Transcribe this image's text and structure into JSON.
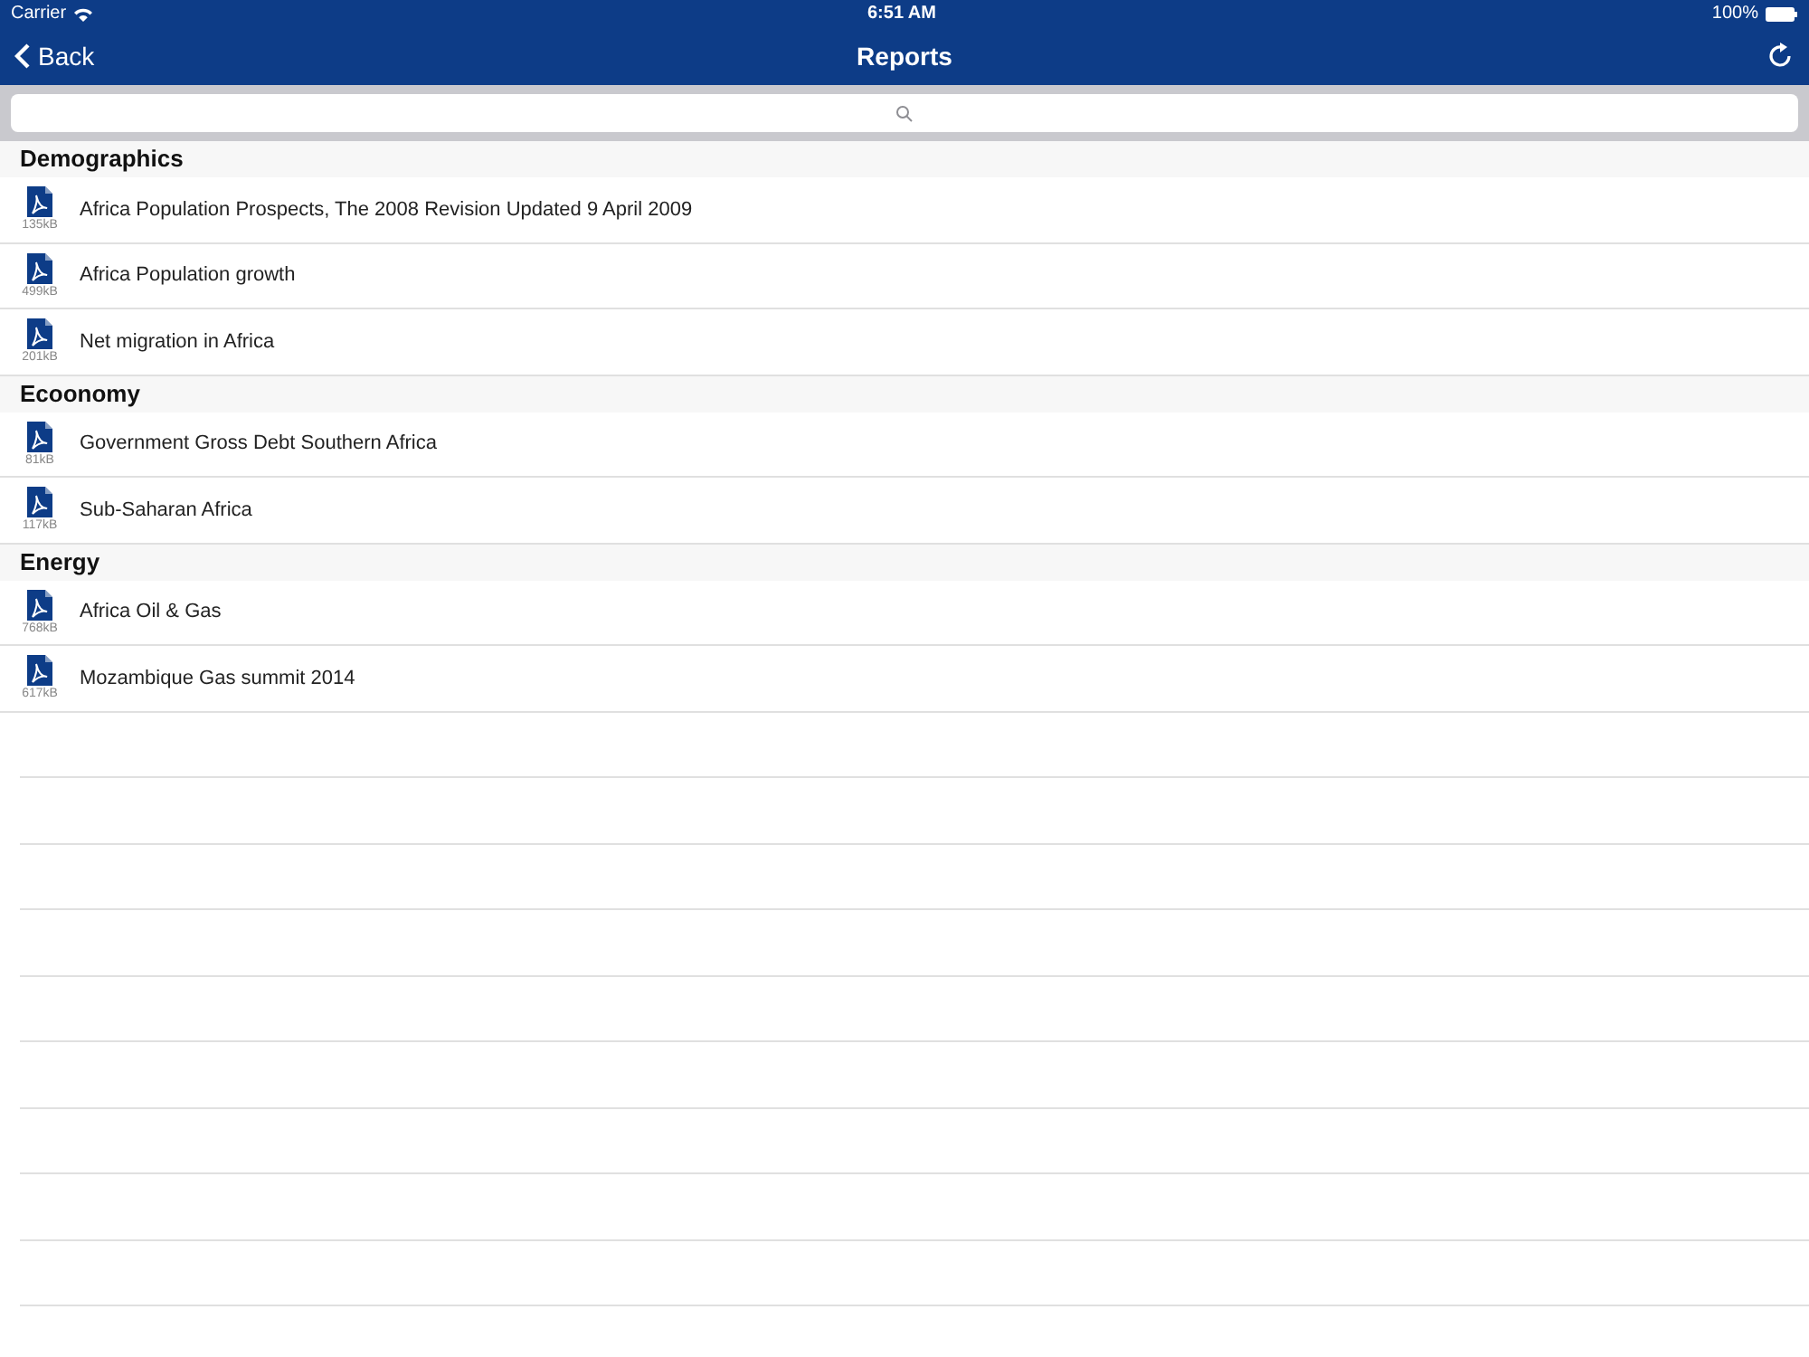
{
  "status_bar": {
    "carrier": "Carrier",
    "time": "6:51 AM",
    "battery": "100%"
  },
  "nav_bar": {
    "back": "Back",
    "title": "Reports"
  },
  "sections": [
    {
      "title": "Demographics",
      "items": [
        {
          "name": "Africa Population Prospects, The 2008 Revision Updated 9 April 2009",
          "size": "135kB"
        },
        {
          "name": "Africa Population growth",
          "size": "499kB"
        },
        {
          "name": "Net migration in Africa",
          "size": "201kB"
        }
      ]
    },
    {
      "title": "Ecoonomy",
      "items": [
        {
          "name": "Government Gross Debt Southern Africa",
          "size": "81kB"
        },
        {
          "name": "Sub-Saharan Africa",
          "size": "117kB"
        }
      ]
    },
    {
      "title": "Energy",
      "items": [
        {
          "name": "Africa Oil & Gas",
          "size": "768kB"
        },
        {
          "name": "Mozambique Gas summit 2014",
          "size": "617kB"
        }
      ]
    }
  ]
}
